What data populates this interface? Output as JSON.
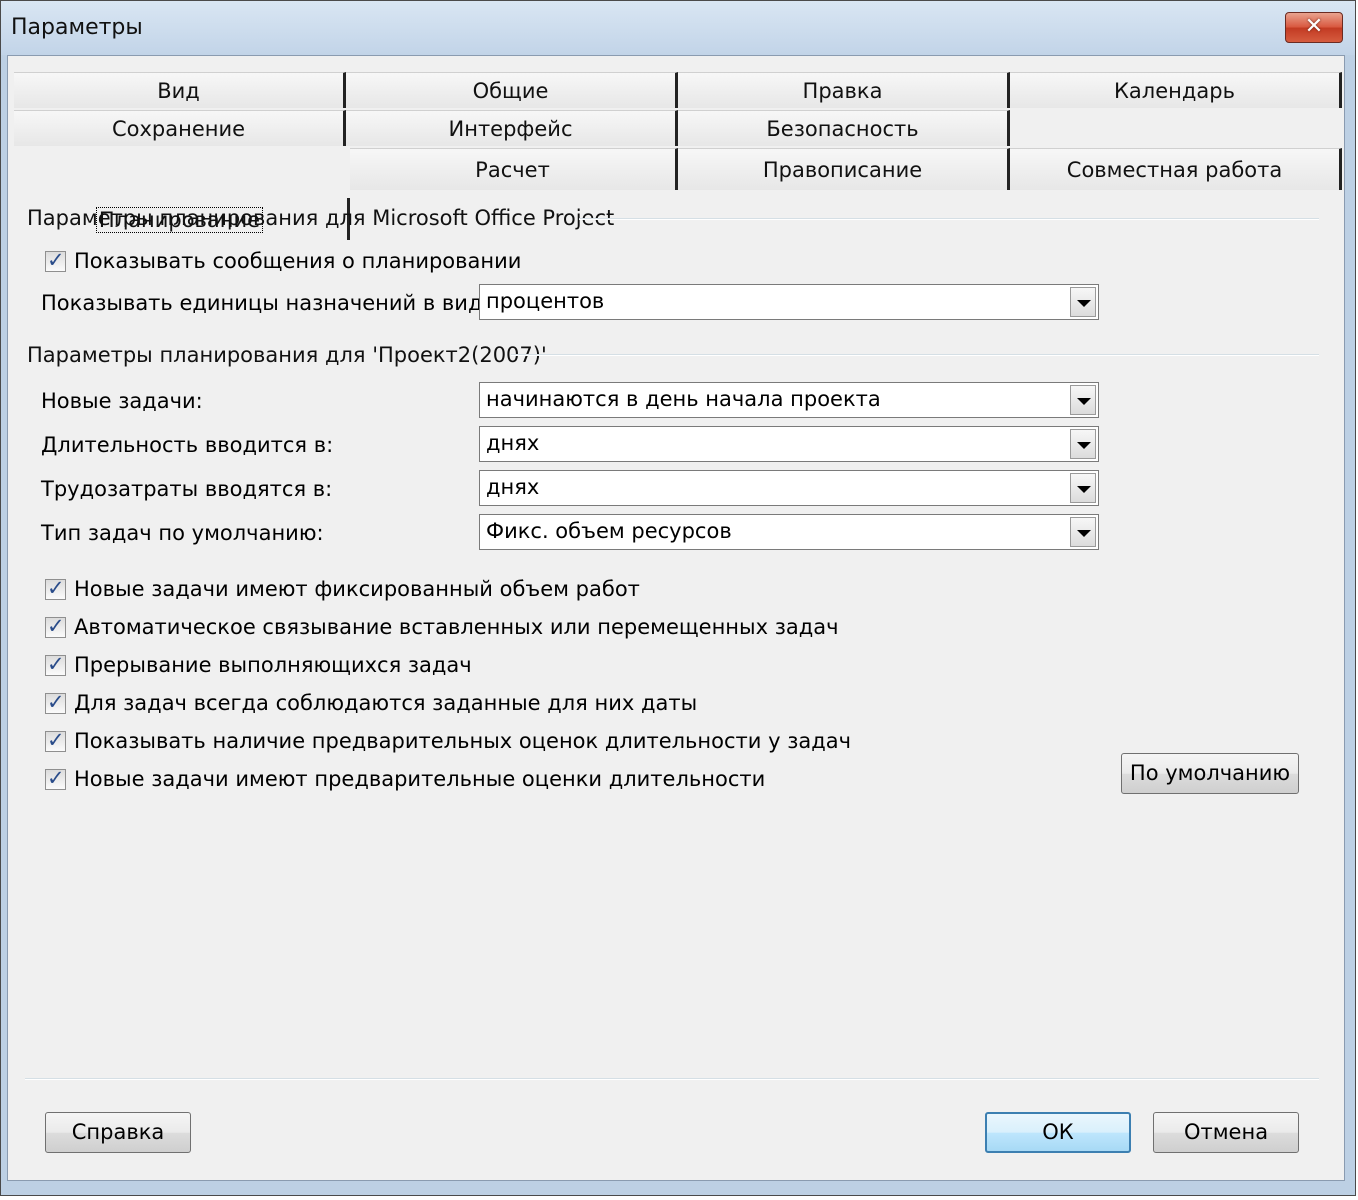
{
  "window": {
    "title": "Параметры",
    "close_label": "✕"
  },
  "tabs": {
    "row1": [
      "Вид",
      "Общие",
      "Правка",
      "Календарь"
    ],
    "row2": [
      "Сохранение",
      "Интерфейс",
      "Безопасность"
    ],
    "row3": [
      "Планирование",
      "Расчет",
      "Правописание",
      "Совместная работа"
    ],
    "active": "Планирование"
  },
  "group1": {
    "title": "Параметры планирования для Microsoft Office Project",
    "show_messages_label": "Показывать сообщения о планировании",
    "show_messages_checked": true,
    "units_label": "Показывать единицы назначений в виде",
    "units_value": "процентов"
  },
  "group2": {
    "title": "Параметры планирования для 'Проект2(2007)'",
    "new_tasks_label": "Новые задачи:",
    "new_tasks_value": "начинаются в день начала проекта",
    "duration_label": "Длительность вводится в:",
    "duration_value": "днях",
    "work_label": "Трудозатраты вводятся в:",
    "work_value": "днях",
    "task_type_label": "Тип задач по умолчанию:",
    "task_type_value": "Фикс. объем ресурсов",
    "checkboxes": [
      {
        "label": "Новые задачи имеют фиксированный объем работ",
        "checked": true
      },
      {
        "label": "Автоматическое связывание вставленных или перемещенных задач",
        "checked": true
      },
      {
        "label": "Прерывание выполняющихся задач",
        "checked": true
      },
      {
        "label": "Для задач всегда соблюдаются заданные для них даты",
        "checked": true
      },
      {
        "label": "Показывать наличие предварительных оценок длительности у задач",
        "checked": true
      },
      {
        "label": "Новые задачи имеют предварительные оценки длительности",
        "checked": true
      }
    ],
    "default_button": "По умолчанию"
  },
  "footer": {
    "help_button": "Справка",
    "ok_button": "ОК",
    "cancel_button": "Отмена"
  },
  "check_glyph": "✓"
}
